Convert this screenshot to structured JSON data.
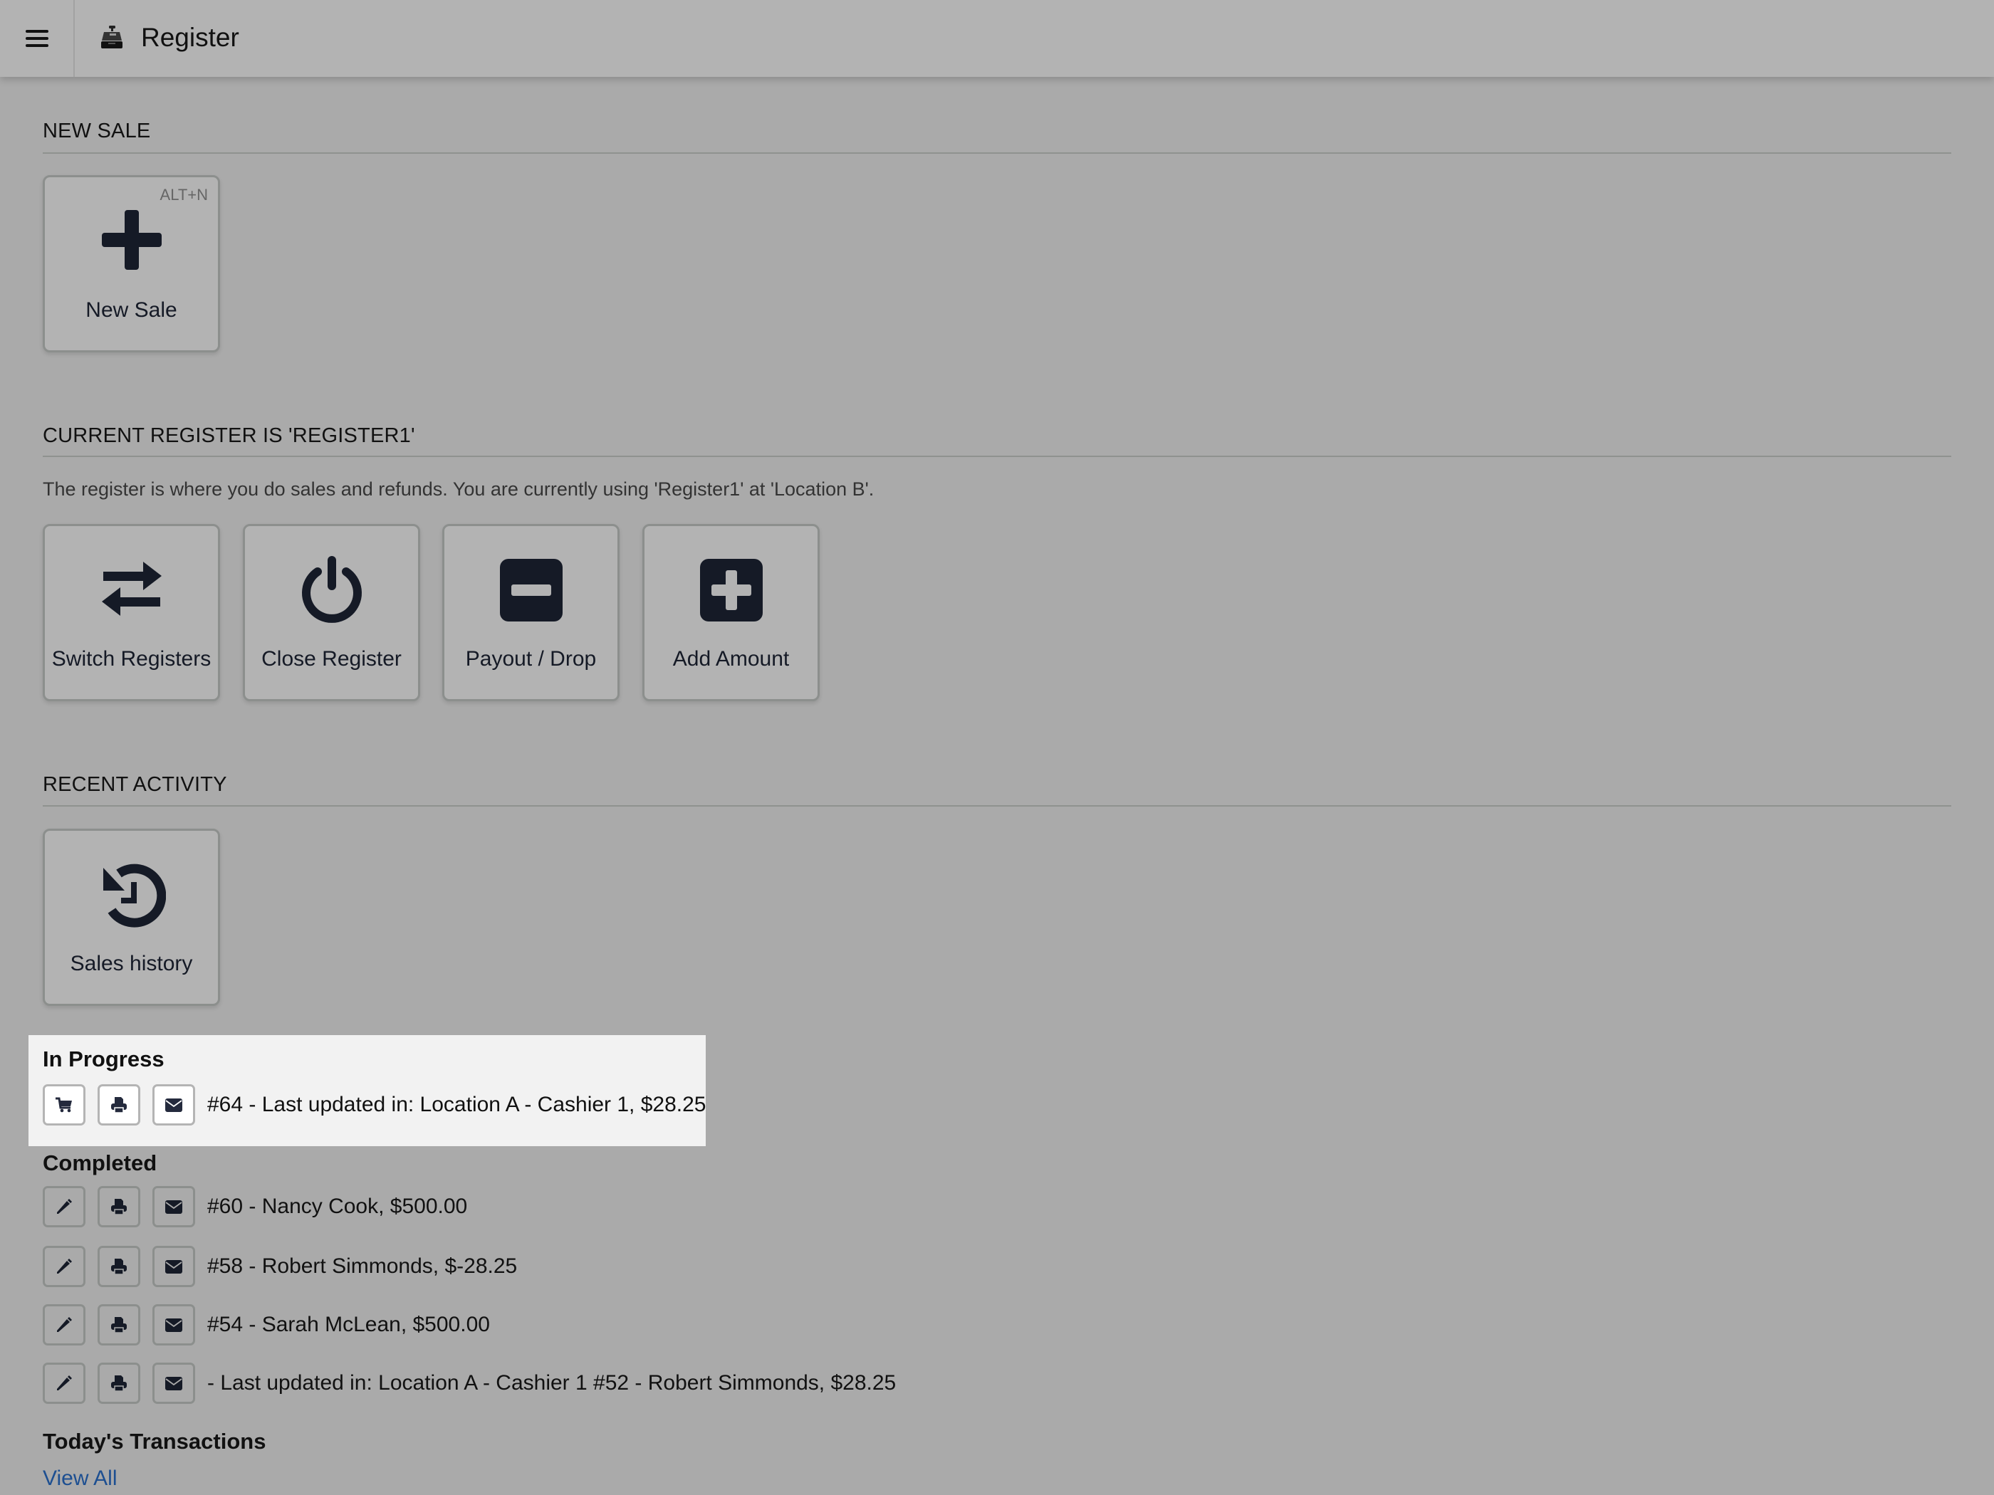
{
  "header": {
    "menu_icon": "hamburger-icon",
    "app_icon": "cash-register-icon",
    "title": "Register"
  },
  "new_sale_section": {
    "title": "NEW SALE",
    "tiles": [
      {
        "label": "New Sale",
        "icon": "plus-icon",
        "shortcut": "ALT+N"
      }
    ]
  },
  "register_section": {
    "title": "CURRENT REGISTER IS 'REGISTER1'",
    "description": "The register is where you do sales and refunds. You are currently using 'Register1'  at 'Location B'.",
    "tiles": [
      {
        "label": "Switch Registers",
        "icon": "exchange-arrows-icon"
      },
      {
        "label": "Close Register",
        "icon": "power-icon"
      },
      {
        "label": "Payout / Drop",
        "icon": "minus-square-icon"
      },
      {
        "label": "Add Amount",
        "icon": "plus-square-icon"
      }
    ]
  },
  "recent_activity_section": {
    "title": "RECENT ACTIVITY",
    "tiles": [
      {
        "label": "Sales history",
        "icon": "history-icon"
      }
    ],
    "in_progress": {
      "title": "In Progress",
      "items": [
        {
          "text": "#64 - Last updated in: Location A - Cashier 1, $28.25",
          "actions": [
            "cart-icon",
            "print-icon",
            "email-icon"
          ]
        }
      ]
    },
    "completed": {
      "title": "Completed",
      "items": [
        {
          "text": "#60 - Nancy Cook, $500.00",
          "actions": [
            "edit-icon",
            "print-icon",
            "email-icon"
          ]
        },
        {
          "text": "#58 - Robert Simmonds, $-28.25",
          "actions": [
            "edit-icon",
            "print-icon",
            "email-icon"
          ]
        },
        {
          "text": "#54 - Sarah McLean, $500.00",
          "actions": [
            "edit-icon",
            "print-icon",
            "email-icon"
          ]
        },
        {
          "text": "- Last updated in: Location A - Cashier 1 #52 - Robert Simmonds, $28.25",
          "actions": [
            "edit-icon",
            "print-icon",
            "email-icon"
          ]
        }
      ]
    },
    "todays_transactions": {
      "title": "Today's Transactions",
      "link": "View All"
    }
  },
  "colors": {
    "background": "#aaaaaa",
    "header": "#b3b3b3",
    "highlight": "#f2f2f2",
    "icon": "#151a26",
    "link": "#1d4f91"
  }
}
